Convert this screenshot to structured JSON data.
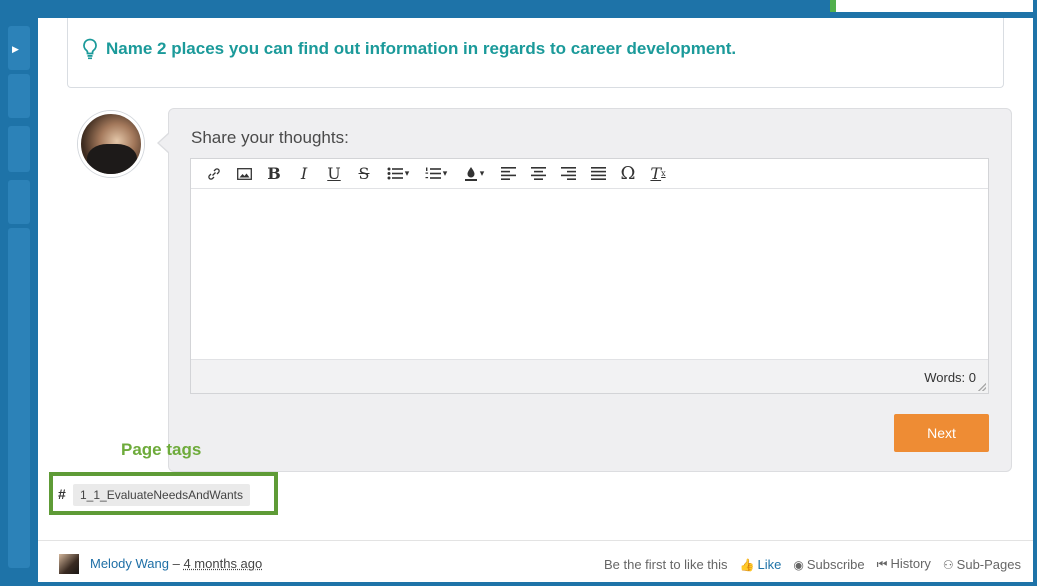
{
  "question": {
    "icon": "lightbulb-icon",
    "text": "Name 2 places you can find out information in regards to career development."
  },
  "thoughts": {
    "label": "Share your thoughts:",
    "toolbar": [
      {
        "name": "link-icon",
        "glyph": "🔗"
      },
      {
        "name": "image-icon",
        "glyph": "▣"
      },
      {
        "name": "bold-icon",
        "glyph": "B"
      },
      {
        "name": "italic-icon",
        "glyph": "I"
      },
      {
        "name": "underline-icon",
        "glyph": "U"
      },
      {
        "name": "strikethrough-icon",
        "glyph": "S"
      },
      {
        "name": "bulleted-list-icon",
        "glyph": "☰"
      },
      {
        "name": "numbered-list-icon",
        "glyph": "☰"
      },
      {
        "name": "text-color-icon",
        "glyph": "●"
      },
      {
        "name": "align-left-icon",
        "glyph": "≡"
      },
      {
        "name": "align-center-icon",
        "glyph": "≡"
      },
      {
        "name": "align-right-icon",
        "glyph": "≡"
      },
      {
        "name": "justify-icon",
        "glyph": "≡"
      },
      {
        "name": "special-char-icon",
        "glyph": "Ω"
      },
      {
        "name": "clear-format-icon",
        "glyph": "T"
      }
    ],
    "word_count": "Words: 0",
    "next_label": "Next"
  },
  "tags": {
    "label": "Page tags",
    "hash": "#",
    "items": [
      "1_1_EvaluateNeedsAndWants"
    ]
  },
  "footer": {
    "author": "Melody Wang",
    "separator": " – ",
    "time": "4 months ago",
    "like_prompt": "Be the first to like this",
    "like_label": "Like",
    "subscribe_label": "Subscribe",
    "history_label": "History",
    "subpages_label": "Sub-Pages"
  },
  "colors": {
    "accent_blue": "#1e73a8",
    "question_teal": "#1b9a9a",
    "next_orange": "#ee8c34",
    "tag_green": "#6eab3b"
  }
}
